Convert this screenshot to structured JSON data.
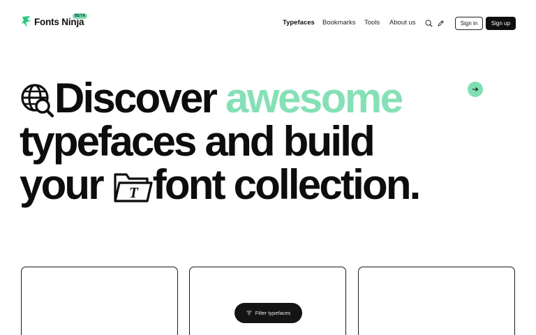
{
  "header": {
    "logo_text": "Fonts Ninja",
    "beta_badge": "BETA",
    "nav": [
      {
        "label": "Typefaces",
        "active": true
      },
      {
        "label": "Bookmarks",
        "active": false
      },
      {
        "label": "Tools",
        "active": false
      },
      {
        "label": "About us",
        "active": false
      }
    ],
    "icons": [
      "search-icon",
      "pen-icon"
    ],
    "signin_label": "Sign in",
    "signup_label": "Sign up"
  },
  "hero": {
    "line1_word": "Discover",
    "line1_accent": "awesome",
    "line2": "typefaces and build",
    "line3_start": "your",
    "line3_end": "font collection."
  },
  "filter": {
    "label": "Filter typefaces"
  },
  "colors": {
    "accent": "#86e0b6",
    "dark": "#0d0d0d",
    "background": "#ffffff"
  }
}
